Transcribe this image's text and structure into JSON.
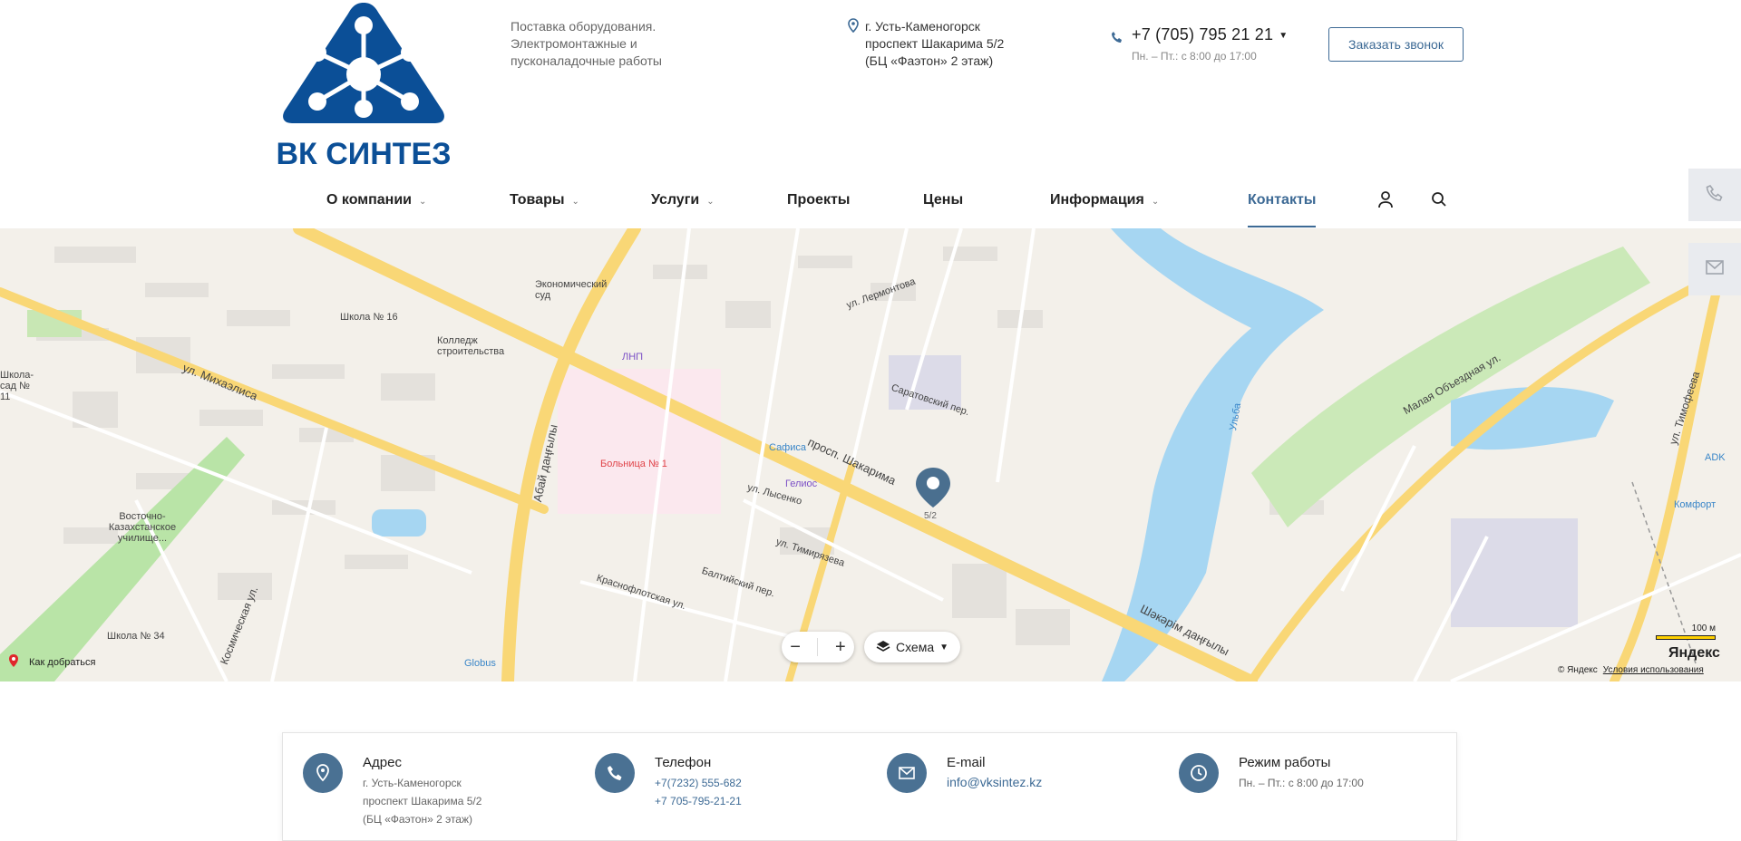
{
  "brand": {
    "logo_text": "ВК СИНТЕЗ",
    "tagline": [
      "Поставка оборудования.",
      "Электромонтажные и",
      "пусконаладочные работы"
    ],
    "accent_color": "#0b4f97"
  },
  "header": {
    "address_lines": [
      "г. Усть-Каменогорск",
      "проспект Шакарима 5/2",
      "(БЦ «Фаэтон» 2 этаж)"
    ],
    "phone": "+7 (705) 795 21 21",
    "hours": "Пн. – Пт.: с 8:00 до 17:00",
    "callback_label": "Заказать звонок"
  },
  "nav": {
    "items": [
      {
        "label": "О компании",
        "has_dropdown": true
      },
      {
        "label": "Товары",
        "has_dropdown": true
      },
      {
        "label": "Услуги",
        "has_dropdown": true
      },
      {
        "label": "Проекты",
        "has_dropdown": false
      },
      {
        "label": "Цены",
        "has_dropdown": false
      },
      {
        "label": "Информация",
        "has_dropdown": true
      },
      {
        "label": "Контакты",
        "has_dropdown": false,
        "active": true
      }
    ],
    "icons": [
      "user-icon",
      "search-icon"
    ]
  },
  "map": {
    "labels": {
      "school16": "Школа № 16",
      "econ_court": "Экономический суд",
      "college": "Колледж строительства",
      "lnp": "ЛНП",
      "hospital": "Больница № 1",
      "safisa": "Сафиса",
      "gelios": "Гелиос",
      "shakarim": "просп. Шакарима",
      "shakarim_kz": "Шәкәрім даңғылы",
      "abay": "Абай даңғылы",
      "mikhaelis": "ул. Михаэлиса",
      "kosmicheskaya": "Космическая ул.",
      "school34": "Школа № 34",
      "vkz_college": "Восточно-Казахстанское училище...",
      "school11": "Школа-сад № 11",
      "lermontova": "ул. Лермонтова",
      "saratovsky": "Саратовский пер.",
      "lysenko": "ул. Лысенко",
      "timiryazeva": "ул. Тимирязева",
      "baltiysky": "Балтийский пер.",
      "krasnoflotskaya": "Краснофлотская ул.",
      "malaya_obezdnaya": "Малая Объездная ул.",
      "timofeeva": "ул. Тимофеева",
      "ulba": "Ульба",
      "adk": "ADK",
      "komfort": "Комфорт",
      "globus": "Globus",
      "marker_label": "5/2"
    },
    "layers_label": "Схема",
    "route_label": "Как добраться",
    "scale_label": "100 м",
    "brand": "Яндекс",
    "copyright": "© Яндекс",
    "terms": "Условия использования"
  },
  "contacts": {
    "address": {
      "title": "Адрес",
      "lines": [
        "г. Усть-Каменогорск",
        "проспект Шакарима 5/2",
        "(БЦ «Фаэтон» 2 этаж)"
      ]
    },
    "phone": {
      "title": "Телефон",
      "lines": [
        "+7(7232) 555-682",
        "+7 705-795-21-21"
      ]
    },
    "email": {
      "title": "E-mail",
      "value": "info@vksintez.kz"
    },
    "hours": {
      "title": "Режим работы",
      "value": "Пн. – Пт.: с 8:00 до 17:00"
    }
  }
}
